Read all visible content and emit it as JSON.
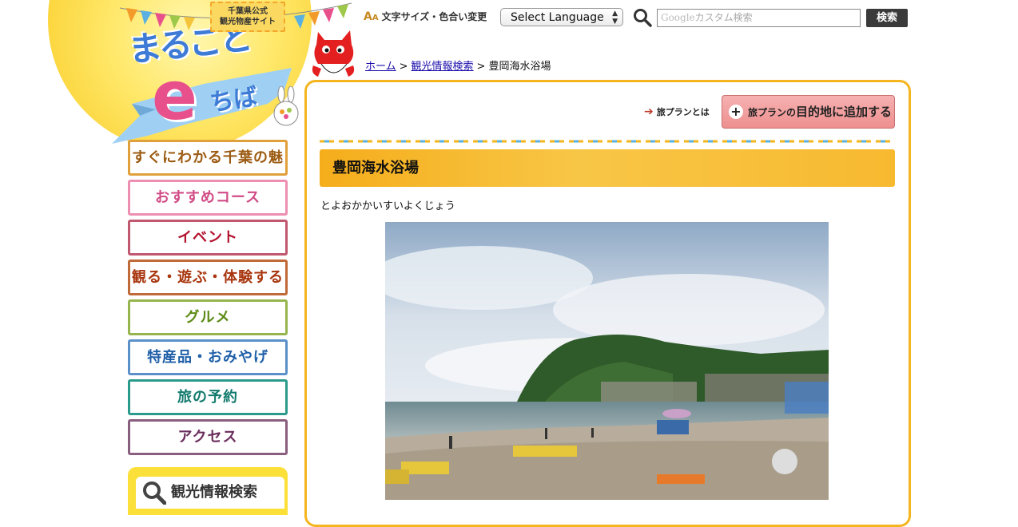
{
  "logo": {
    "badge_line1": "千葉県公式",
    "badge_line2": "観光物産サイト",
    "title_top": "まるごと",
    "title_e": "e",
    "title_chiba": "ちば"
  },
  "toolbar": {
    "font_size_color": "文字サイズ・色合い変更",
    "language_label": "Select Language",
    "search_placeholder_brand": "Google",
    "search_placeholder": "カスタム検索",
    "search_button": "検索"
  },
  "breadcrumb": {
    "items": [
      "ホーム",
      "観光情報検索",
      "豊岡海水浴場"
    ],
    "separator": ">"
  },
  "sidebar": {
    "items": [
      {
        "label": "すぐにわかる千葉の魅力",
        "color": "#e0a13c",
        "text_color": "#9c5b12"
      },
      {
        "label": "おすすめコース",
        "color": "#ec8fb1",
        "text_color": "#d14c86"
      },
      {
        "label": "イベント",
        "color": "#c05870",
        "text_color": "#b3132f"
      },
      {
        "label": "観る・遊ぶ・体験する",
        "color": "#c06a3a",
        "text_color": "#a8360f"
      },
      {
        "label": "グルメ",
        "color": "#97b54f",
        "text_color": "#5c8a14"
      },
      {
        "label": "特産品・おみやげ",
        "color": "#5b90c8",
        "text_color": "#1f5fa8"
      },
      {
        "label": "旅の予約",
        "color": "#2a9a8c",
        "text_color": "#137a6e"
      },
      {
        "label": "アクセス",
        "color": "#8a5e7e",
        "text_color": "#6a2d5c"
      }
    ],
    "search_label": "観光情報検索"
  },
  "main": {
    "plan_what": "旅プランとは",
    "plan_add_prefix": "旅プランの",
    "plan_add_main": "目的地に追加する",
    "title": "豊岡海水浴場",
    "reading": "とよおかかいすいよくじょう"
  },
  "colors": {
    "frame_border": "#f4b51e",
    "title_bar": "#f5ad1b",
    "search_button_bg": "#3a3a3a"
  }
}
